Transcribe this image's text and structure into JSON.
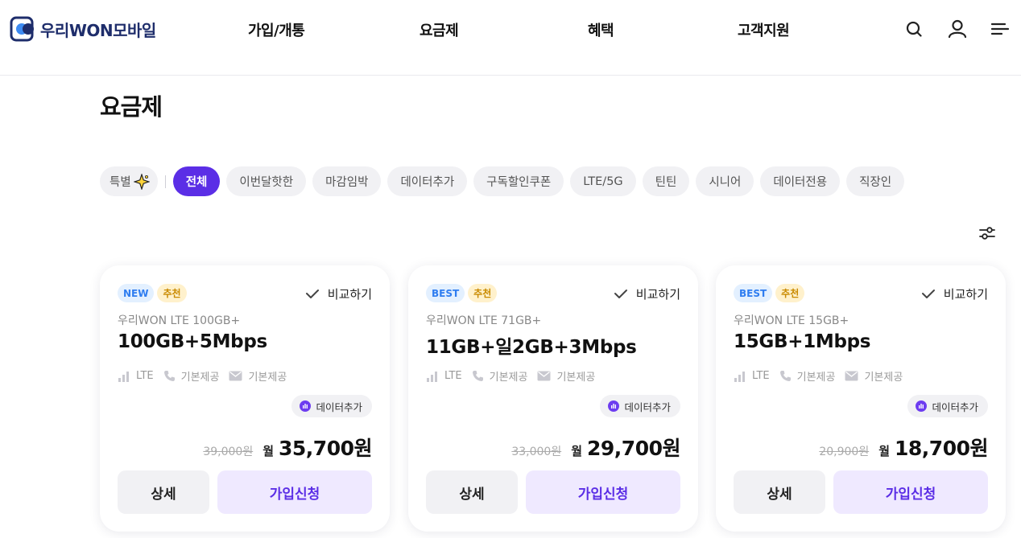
{
  "header": {
    "logo_prefix": "우리",
    "logo_won": "WON",
    "logo_suffix": "모바일",
    "nav": [
      "가입/개통",
      "요금제",
      "혜택",
      "고객지원"
    ],
    "icons": [
      "search-icon",
      "user-icon",
      "menu-icon"
    ]
  },
  "page": {
    "title": "요금제"
  },
  "chips": {
    "special": "특별",
    "items": [
      "전체",
      "이번달핫한",
      "마감임박",
      "데이터추가",
      "구독할인쿠폰",
      "LTE/5G",
      "틴틴",
      "시니어",
      "데이터전용",
      "직장인"
    ],
    "active_index": 0
  },
  "colors": {
    "accent": "#5b2ee6",
    "accent_light": "#efe9ff",
    "badge_blue": "#2f7df0",
    "badge_yellow": "#c98a00"
  },
  "cards": [
    {
      "badges": [
        "NEW",
        "추천"
      ],
      "compare": "비교하기",
      "sub": "우리WON LTE 100GB+",
      "name": "100GB+5Mbps",
      "network": "LTE",
      "voice": "기본제공",
      "sms": "기본제공",
      "tag": "데이터추가",
      "old_price": "39,000원",
      "month": "월",
      "price": "35,700원",
      "detail": "상세",
      "join": "가입신청"
    },
    {
      "badges": [
        "BEST",
        "추천"
      ],
      "compare": "비교하기",
      "sub": "우리WON LTE 71GB+",
      "name": "11GB+일2GB+3Mbps",
      "network": "LTE",
      "voice": "기본제공",
      "sms": "기본제공",
      "tag": "데이터추가",
      "old_price": "33,000원",
      "month": "월",
      "price": "29,700원",
      "detail": "상세",
      "join": "가입신청"
    },
    {
      "badges": [
        "BEST",
        "추천"
      ],
      "compare": "비교하기",
      "sub": "우리WON LTE 15GB+",
      "name": "15GB+1Mbps",
      "network": "LTE",
      "voice": "기본제공",
      "sms": "기본제공",
      "tag": "데이터추가",
      "old_price": "20,900원",
      "month": "월",
      "price": "18,700원",
      "detail": "상세",
      "join": "가입신청"
    }
  ]
}
